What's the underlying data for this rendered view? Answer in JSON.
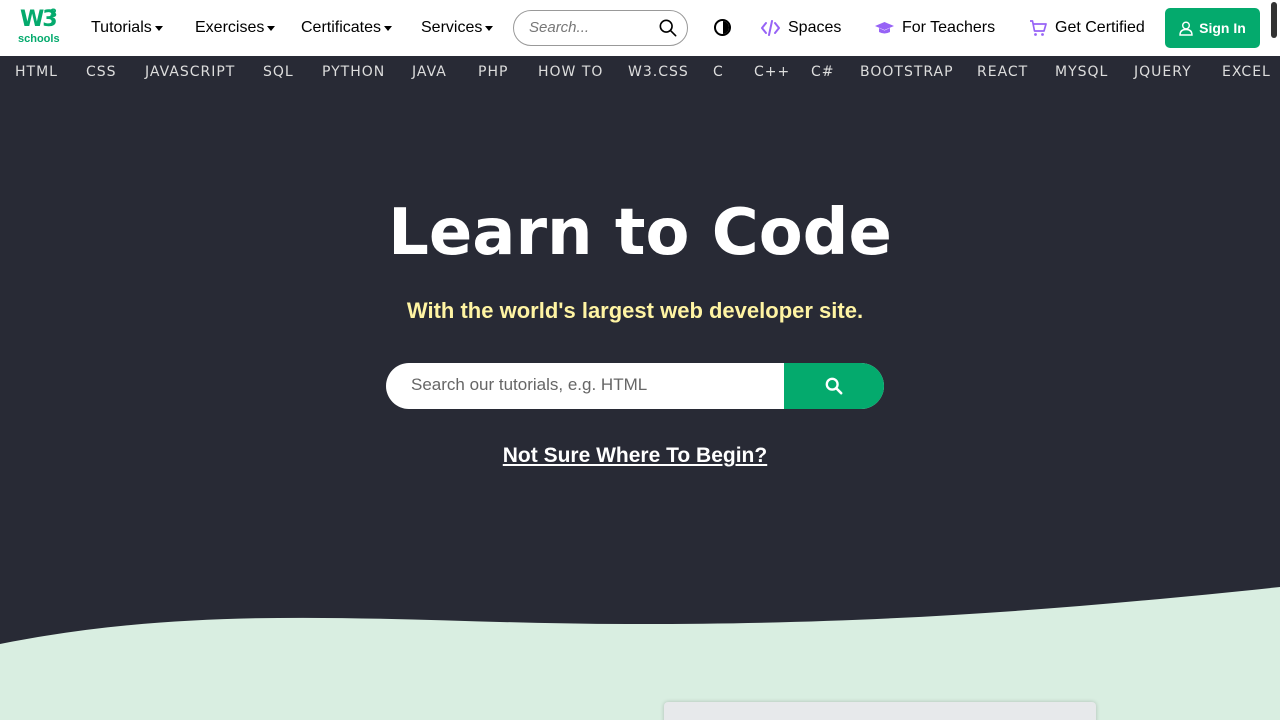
{
  "brand": {
    "logo_main": "W3",
    "logo_sup": "3",
    "logo_sub": "schools",
    "accent": "#04AA6D",
    "dark_bg": "#282A35",
    "highlight": "#FFF4A3",
    "wave_color": "#D9EEE1"
  },
  "nav": {
    "menus": [
      {
        "label": "Tutorials"
      },
      {
        "label": "Exercises"
      },
      {
        "label": "Certificates"
      },
      {
        "label": "Services"
      }
    ],
    "search_placeholder": "Search...",
    "spaces": "Spaces",
    "for_teachers": "For Teachers",
    "get_certified": "Get Certified",
    "sign_in": "Sign In"
  },
  "subjects": [
    "HTML",
    "CSS",
    "JAVASCRIPT",
    "SQL",
    "PYTHON",
    "JAVA",
    "PHP",
    "HOW TO",
    "W3.CSS",
    "C",
    "C++",
    "C#",
    "BOOTSTRAP",
    "REACT",
    "MYSQL",
    "JQUERY",
    "EXCEL"
  ],
  "hero": {
    "title": "Learn to Code",
    "subtitle": "With the world's largest web developer site.",
    "search_placeholder": "Search our tutorials, e.g. HTML",
    "link": "Not Sure Where To Begin?"
  }
}
